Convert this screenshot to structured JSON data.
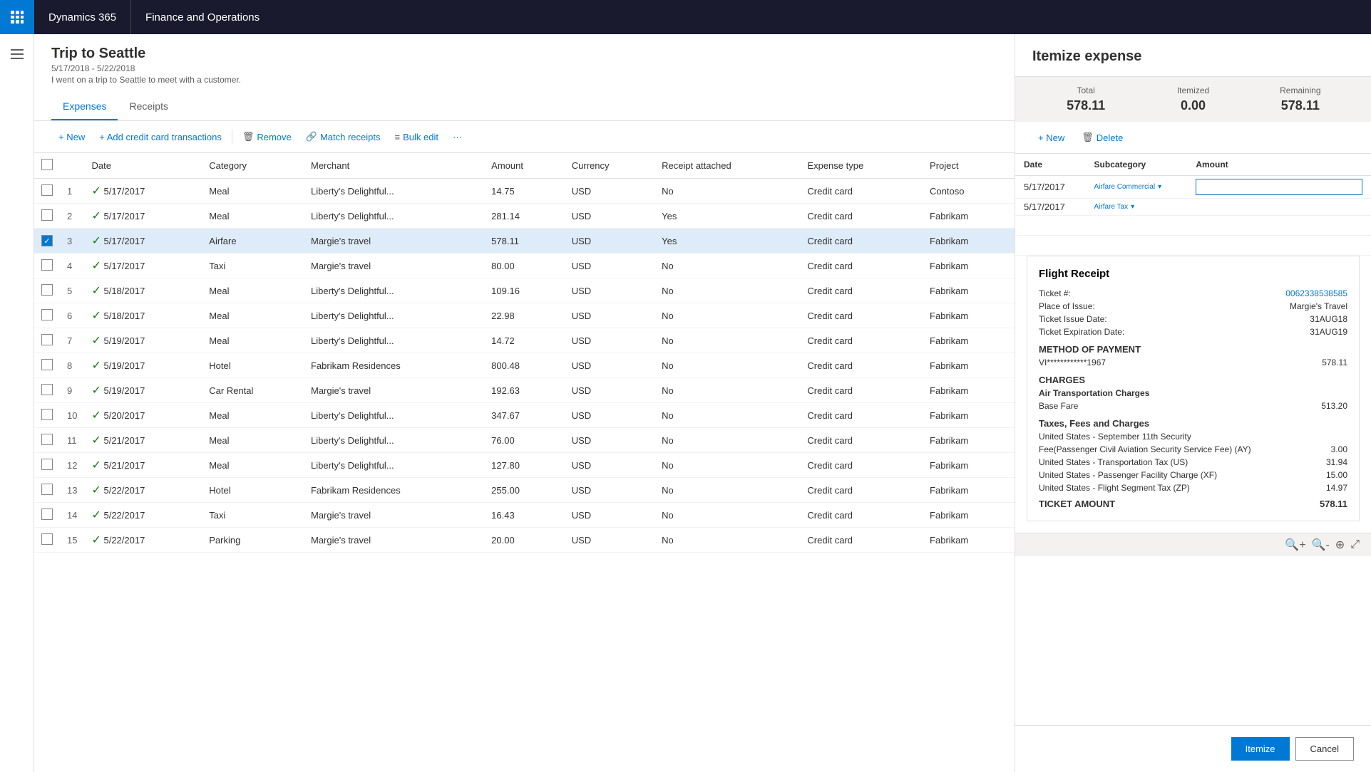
{
  "nav": {
    "dynamics_label": "Dynamics 365",
    "finance_label": "Finance and Operations"
  },
  "page": {
    "title": "Trip to Seattle",
    "dates": "5/17/2018 - 5/22/2018",
    "description": "I went on a trip to Seattle to meet with a customer."
  },
  "tabs": [
    {
      "id": "expenses",
      "label": "Expenses",
      "active": true
    },
    {
      "id": "receipts",
      "label": "Receipts",
      "active": false
    }
  ],
  "toolbar": {
    "new_label": "+ New",
    "add_cc_label": "+ Add credit card transactions",
    "remove_label": "Remove",
    "match_receipts_label": "Match receipts",
    "bulk_edit_label": "Bulk edit"
  },
  "table": {
    "headers": [
      "",
      "",
      "Date",
      "Category",
      "Merchant",
      "Amount",
      "Currency",
      "Receipt attached",
      "Expense type",
      "Project"
    ],
    "rows": [
      {
        "num": 1,
        "status": "ok",
        "date": "5/17/2017",
        "category": "Meal",
        "merchant": "Liberty's Delightful...",
        "amount": "14.75",
        "currency": "USD",
        "receipt": "No",
        "expense_type": "Credit card",
        "project": "Contoso"
      },
      {
        "num": 2,
        "status": "ok",
        "date": "5/17/2017",
        "category": "Meal",
        "merchant": "Liberty's Delightful...",
        "amount": "281.14",
        "currency": "USD",
        "receipt": "Yes",
        "expense_type": "Credit card",
        "project": "Fabrikam"
      },
      {
        "num": 3,
        "status": "ok",
        "date": "5/17/2017",
        "category": "Airfare",
        "merchant": "Margie's travel",
        "amount": "578.11",
        "currency": "USD",
        "receipt": "Yes",
        "expense_type": "Credit card",
        "project": "Fabrikam",
        "selected": true
      },
      {
        "num": 4,
        "status": "ok",
        "date": "5/17/2017",
        "category": "Taxi",
        "merchant": "Margie's travel",
        "amount": "80.00",
        "currency": "USD",
        "receipt": "No",
        "expense_type": "Credit card",
        "project": "Fabrikam"
      },
      {
        "num": 5,
        "status": "ok",
        "date": "5/18/2017",
        "category": "Meal",
        "merchant": "Liberty's Delightful...",
        "amount": "109.16",
        "currency": "USD",
        "receipt": "No",
        "expense_type": "Credit card",
        "project": "Fabrikam"
      },
      {
        "num": 6,
        "status": "ok",
        "date": "5/18/2017",
        "category": "Meal",
        "merchant": "Liberty's Delightful...",
        "amount": "22.98",
        "currency": "USD",
        "receipt": "No",
        "expense_type": "Credit card",
        "project": "Fabrikam"
      },
      {
        "num": 7,
        "status": "ok",
        "date": "5/19/2017",
        "category": "Meal",
        "merchant": "Liberty's Delightful...",
        "amount": "14.72",
        "currency": "USD",
        "receipt": "No",
        "expense_type": "Credit card",
        "project": "Fabrikam"
      },
      {
        "num": 8,
        "status": "ok",
        "date": "5/19/2017",
        "category": "Hotel",
        "merchant": "Fabrikam Residences",
        "amount": "800.48",
        "currency": "USD",
        "receipt": "No",
        "expense_type": "Credit card",
        "project": "Fabrikam"
      },
      {
        "num": 9,
        "status": "ok",
        "date": "5/19/2017",
        "category": "Car Rental",
        "merchant": "Margie's travel",
        "amount": "192.63",
        "currency": "USD",
        "receipt": "No",
        "expense_type": "Credit card",
        "project": "Fabrikam"
      },
      {
        "num": 10,
        "status": "ok",
        "date": "5/20/2017",
        "category": "Meal",
        "merchant": "Liberty's Delightful...",
        "amount": "347.67",
        "currency": "USD",
        "receipt": "No",
        "expense_type": "Credit card",
        "project": "Fabrikam"
      },
      {
        "num": 11,
        "status": "ok",
        "date": "5/21/2017",
        "category": "Meal",
        "merchant": "Liberty's Delightful...",
        "amount": "76.00",
        "currency": "USD",
        "receipt": "No",
        "expense_type": "Credit card",
        "project": "Fabrikam"
      },
      {
        "num": 12,
        "status": "ok",
        "date": "5/21/2017",
        "category": "Meal",
        "merchant": "Liberty's Delightful...",
        "amount": "127.80",
        "currency": "USD",
        "receipt": "No",
        "expense_type": "Credit card",
        "project": "Fabrikam"
      },
      {
        "num": 13,
        "status": "ok",
        "date": "5/22/2017",
        "category": "Hotel",
        "merchant": "Fabrikam Residences",
        "amount": "255.00",
        "currency": "USD",
        "receipt": "No",
        "expense_type": "Credit card",
        "project": "Fabrikam"
      },
      {
        "num": 14,
        "status": "ok",
        "date": "5/22/2017",
        "category": "Taxi",
        "merchant": "Margie's travel",
        "amount": "16.43",
        "currency": "USD",
        "receipt": "No",
        "expense_type": "Credit card",
        "project": "Fabrikam"
      },
      {
        "num": 15,
        "status": "ok",
        "date": "5/22/2017",
        "category": "Parking",
        "merchant": "Margie's travel",
        "amount": "20.00",
        "currency": "USD",
        "receipt": "No",
        "expense_type": "Credit card",
        "project": "Fabrikam"
      }
    ]
  },
  "itemize_panel": {
    "title": "Itemize expense",
    "summary": {
      "total_label": "Total",
      "total_value": "578.11",
      "itemized_label": "Itemized",
      "itemized_value": "0.00",
      "remaining_label": "Remaining",
      "remaining_value": "578.11"
    },
    "toolbar": {
      "new_label": "+ New",
      "delete_label": "Delete"
    },
    "table_headers": [
      "Date",
      "Subcategory",
      "Amount"
    ],
    "rows": [
      {
        "date": "5/17/2017",
        "subcategory": "Airfare Commercial",
        "amount": "",
        "editable": true
      },
      {
        "date": "5/17/2017",
        "subcategory": "Airfare Tax",
        "amount": "",
        "editable": false
      }
    ],
    "receipt": {
      "title": "Flight Receipt",
      "ticket_number_label": "Ticket #:",
      "ticket_number": "0062338538585",
      "place_of_issue_label": "Place of Issue:",
      "place_of_issue": "Margie's Travel",
      "ticket_issue_date_label": "Ticket Issue Date:",
      "ticket_issue_date": "31AUG18",
      "ticket_expiration_label": "Ticket Expiration Date:",
      "ticket_expiration": "31AUG19",
      "payment_method_header": "METHOD OF PAYMENT",
      "card_number": "VI************1967",
      "card_amount": "578.11",
      "charges_header": "CHARGES",
      "air_transport_header": "Air Transportation Charges",
      "base_fare_label": "Base Fare",
      "base_fare_amount": "513.20",
      "taxes_header": "Taxes, Fees and Charges",
      "tax_rows": [
        {
          "label": "United States - September 11th Security",
          "amount": ""
        },
        {
          "label": "Fee(Passenger Civil Aviation Security Service Fee) (AY)",
          "amount": "3.00"
        },
        {
          "label": "United States - Transportation Tax (US)",
          "amount": "31.94"
        },
        {
          "label": "United States - Passenger Facility Charge (XF)",
          "amount": "15.00"
        },
        {
          "label": "United States - Flight Segment Tax (ZP)",
          "amount": "14.97"
        }
      ],
      "ticket_amount_label": "TICKET AMOUNT",
      "ticket_amount": "578.11"
    },
    "footer": {
      "itemize_label": "Itemize",
      "cancel_label": "Cancel"
    }
  }
}
